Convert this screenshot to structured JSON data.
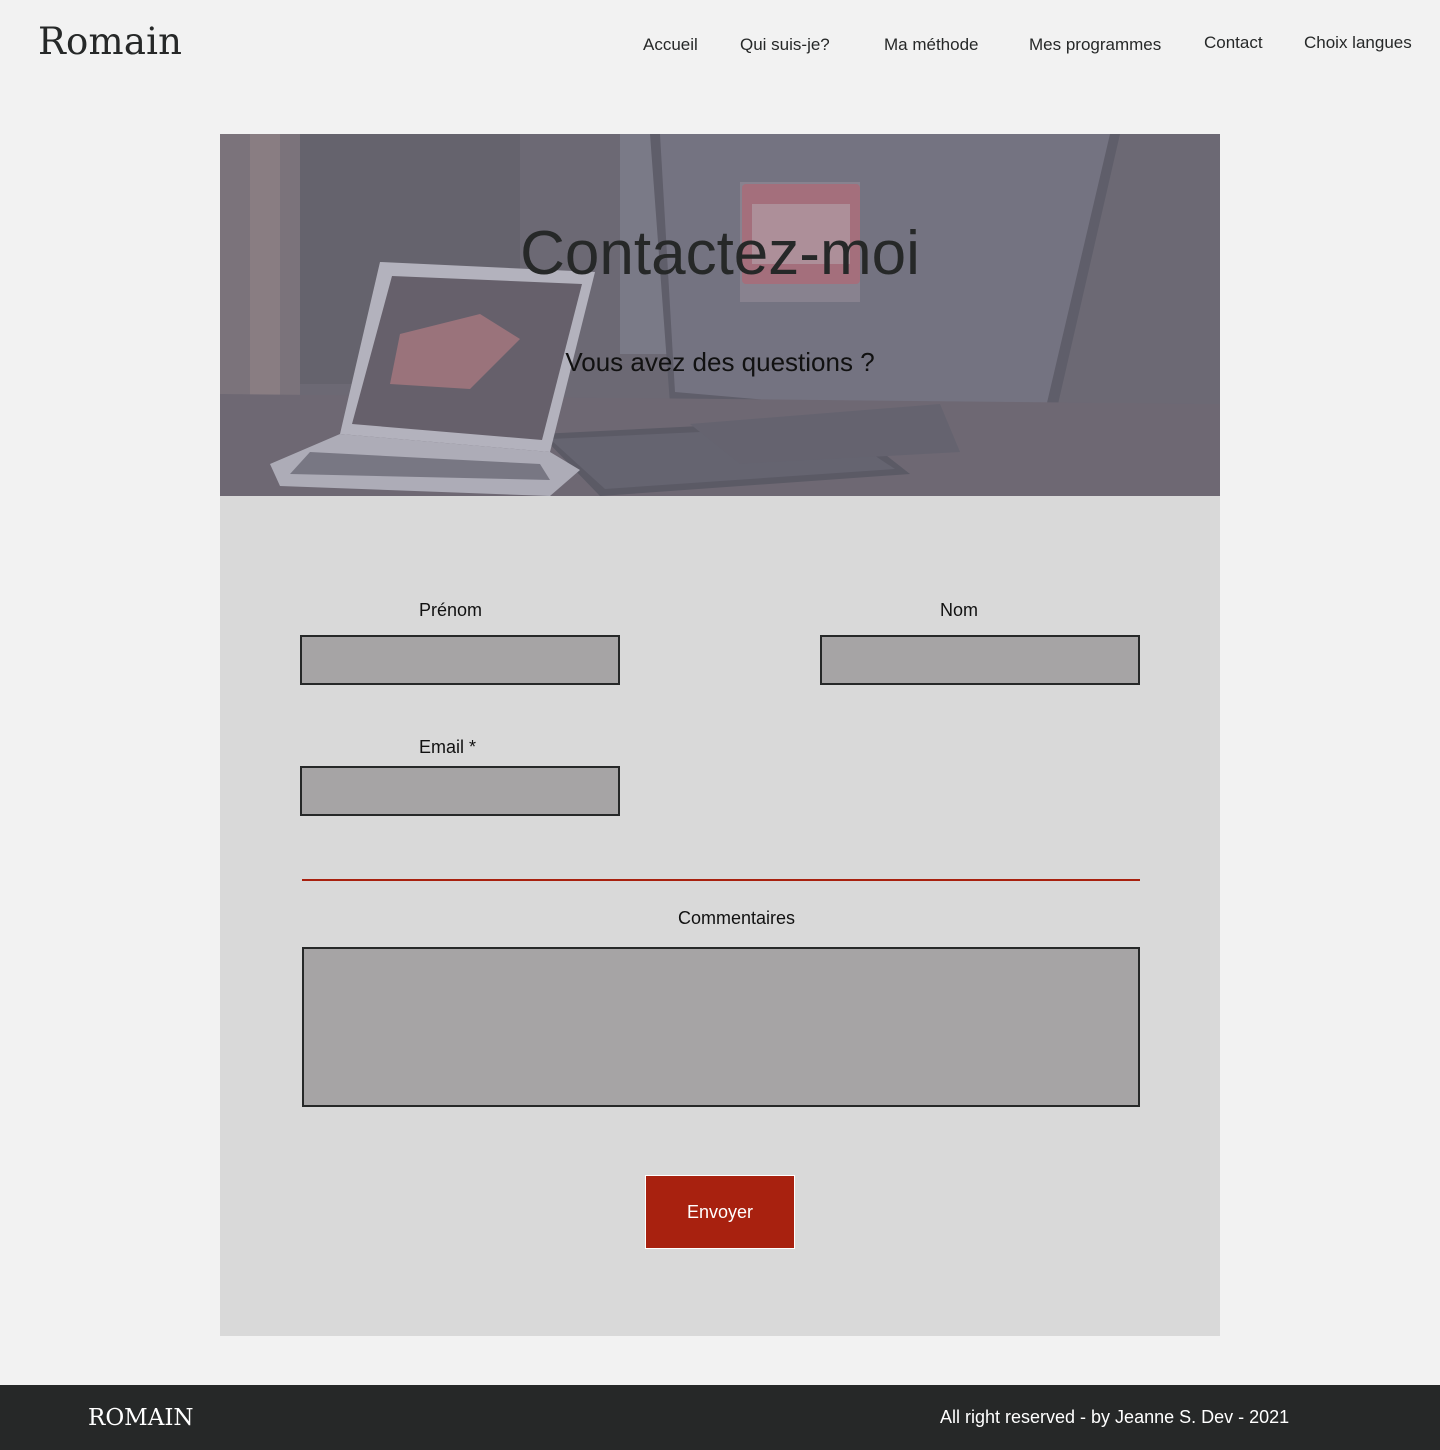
{
  "header": {
    "brand": "Romain",
    "nav": [
      {
        "label": "Accueil"
      },
      {
        "label": "Qui suis-je?"
      },
      {
        "label": "Ma méthode"
      },
      {
        "label": "Mes programmes"
      },
      {
        "label": "Contact"
      },
      {
        "label": "Choix langues"
      }
    ]
  },
  "hero": {
    "title": "Contactez-moi",
    "subtitle": "Vous avez des questions ?",
    "image_description_icon": "laptop-desk-photo"
  },
  "form": {
    "first_name": {
      "label": "Prénom",
      "value": ""
    },
    "last_name": {
      "label": "Nom",
      "value": ""
    },
    "email": {
      "label": "Email *",
      "value": ""
    },
    "comments": {
      "label": "Commentaires",
      "value": ""
    },
    "submit_label": "Envoyer"
  },
  "footer": {
    "brand": "ROMAIN",
    "copyright": "All right reserved - by Jeanne S. Dev - 2021"
  },
  "colors": {
    "accent": "#a8210f",
    "page_background": "#f2f2f2",
    "card_background": "#d9d9d9",
    "input_background": "#a6a4a5",
    "footer_background": "#262828",
    "text_dark": "#262828"
  }
}
